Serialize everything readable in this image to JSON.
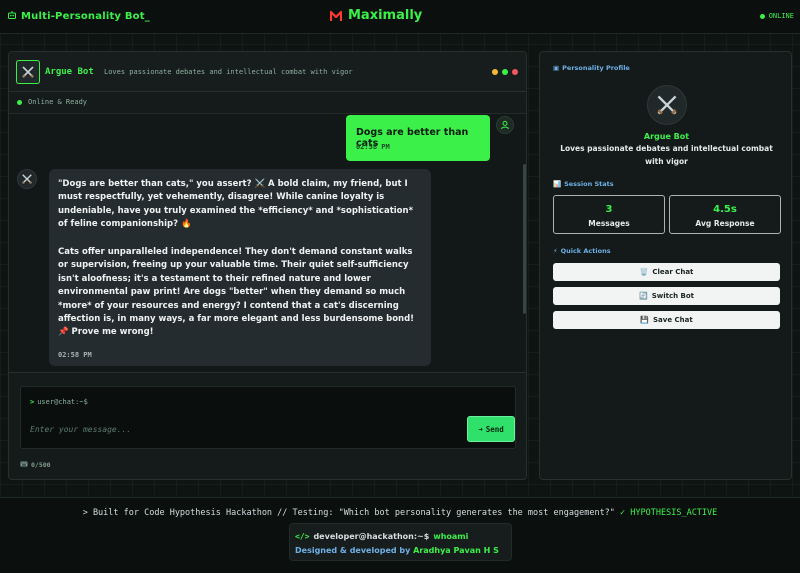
{
  "topbar": {
    "app_title": "Multi-Personality Bot_",
    "brand": "Maximally",
    "status": "ONLINE",
    "icons": {
      "app": "robot-icon",
      "brand": "m-logo-icon"
    }
  },
  "chat": {
    "bot_name": "Argue Bot",
    "bot_desc": "Loves passionate debates and intellectual combat with vigor",
    "status_text": "Online & Ready",
    "window_dot_colors": [
      "#f5b73b",
      "#3cf04a",
      "#f05a5a"
    ],
    "messages": {
      "user": {
        "text": "Dogs are better than cats",
        "time": "02:58 PM"
      },
      "bot": {
        "p1": "\"Dogs are better than cats,\" you assert? ⚔️ A bold claim, my friend, but I must respectfully, yet vehemently, disagree! While canine loyalty is undeniable, have you truly examined the *efficiency* and *sophistication* of feline companionship? 🔥",
        "p2": "Cats offer unparalleled independence! They don't demand constant walks or supervision, freeing up your valuable time. Their quiet self-sufficiency isn't aloofness; it's a testament to their refined nature and lower environmental paw print! Are dogs \"better\" when they demand so much *more* of your resources and energy? I contend that a cat's discerning affection is, in many ways, a far more elegant and less burdensome bond! 📌 Prove me wrong!",
        "time": "02:58 PM"
      }
    },
    "input": {
      "prompt": "user@chat:~$",
      "placeholder": "Enter your message...",
      "value": "",
      "send_label": "Send",
      "char_count": "0/500"
    }
  },
  "sidebar": {
    "profile_title": "Personality Profile",
    "profile_name": "Argue Bot",
    "profile_desc": "Loves passionate debates and intellectual combat with vigor",
    "stats_title": "Session Stats",
    "stats": [
      {
        "value": "3",
        "label": "Messages"
      },
      {
        "value": "4.5s",
        "label": "Avg Response"
      }
    ],
    "actions_title": "Quick Actions",
    "actions": [
      {
        "label": "Clear Chat",
        "icon": "🗑️"
      },
      {
        "label": "Switch Bot",
        "icon": "🔄"
      },
      {
        "label": "Save Chat",
        "icon": "💾"
      }
    ]
  },
  "footer": {
    "line_prefix": "> Built for Code Hypothesis Hackathon // Testing: \"Which bot personality generates the most engagement?\"",
    "line_hyp": "✓ HYPOTHESIS_ACTIVE",
    "credit_cmd_prefix": "developer@hackathon:~$",
    "credit_cmd": "whoami",
    "credit_designed": "Designed & developed by",
    "credit_author": "Aradhya Pavan H S"
  },
  "colors": {
    "accent": "#3cf04a",
    "info": "#6fb0e8",
    "panel": "#131a19",
    "bot_bubble": "#252c2f"
  }
}
